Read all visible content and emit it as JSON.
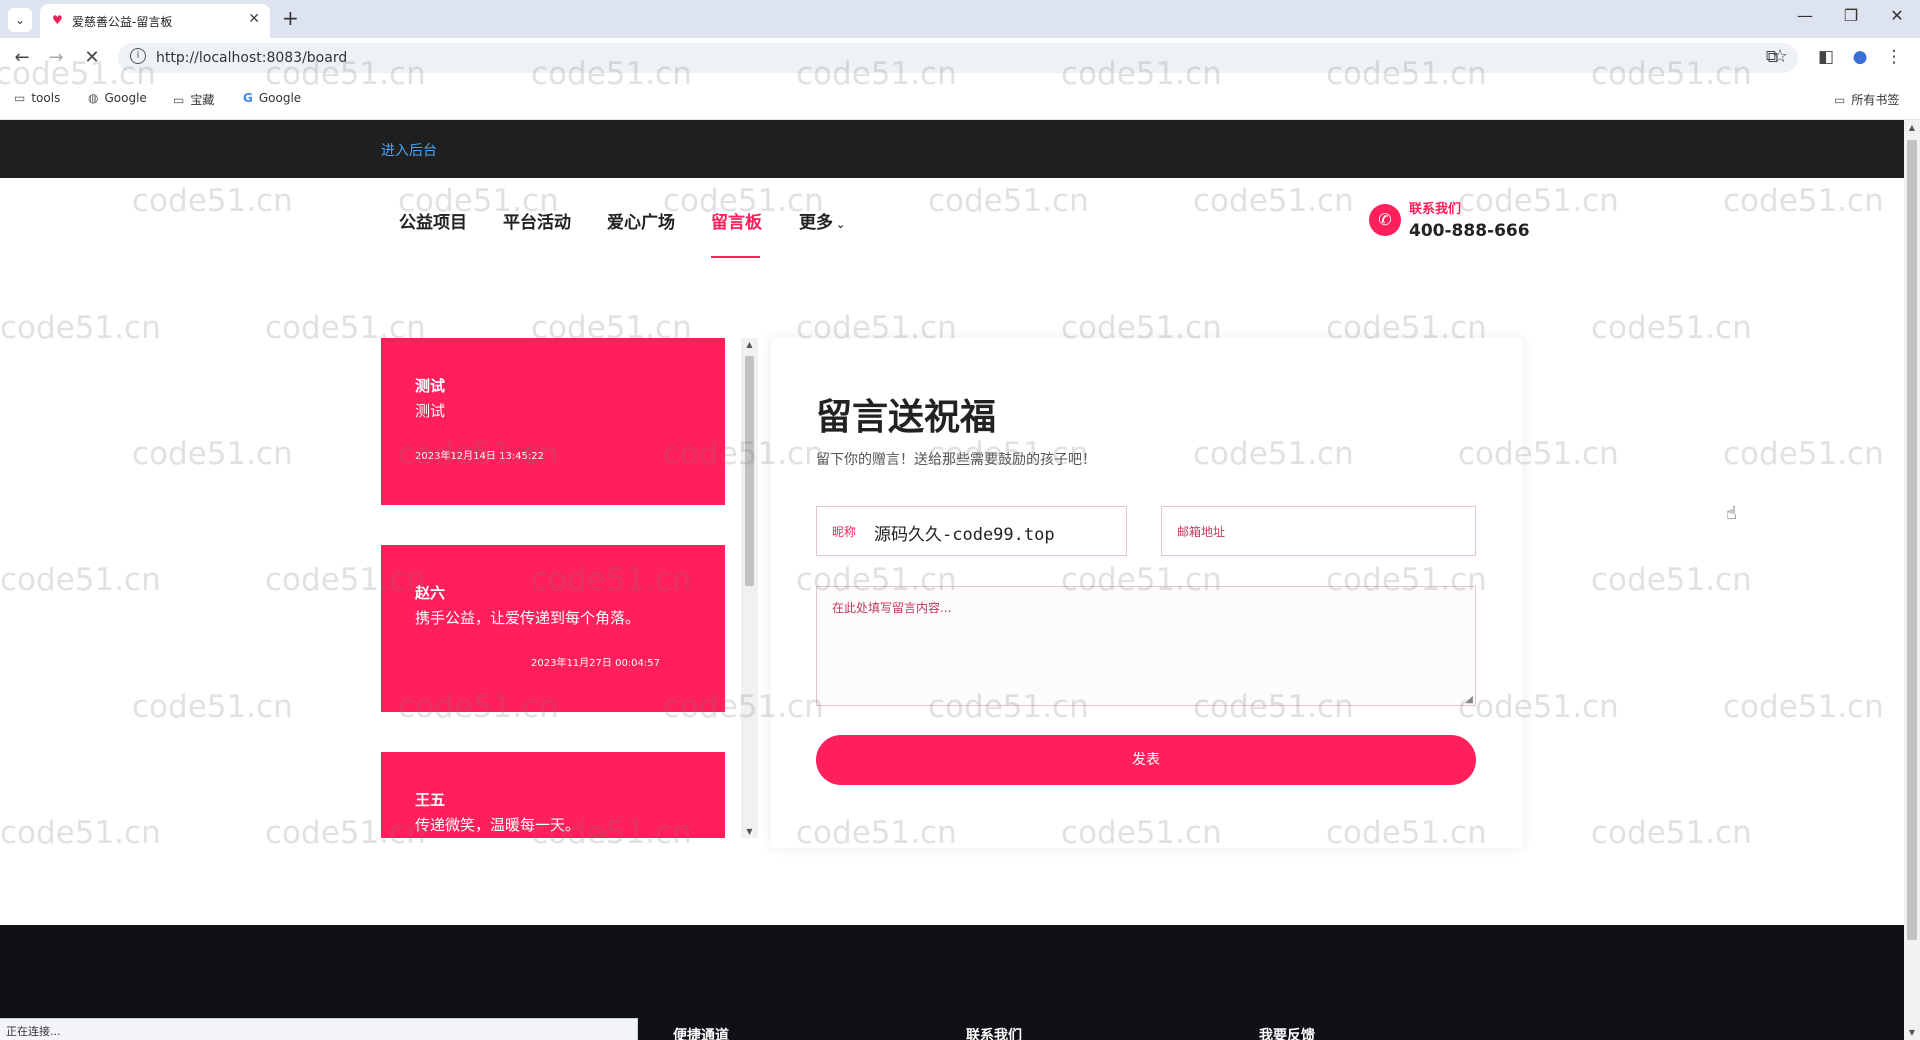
{
  "browser": {
    "tab_title": "爱慈善公益-留言板",
    "url": "http://localhost:8083/board",
    "bookmarks": [
      {
        "label": "tools",
        "icon": "folder-icon"
      },
      {
        "label": "Google",
        "icon": "globe-icon"
      },
      {
        "label": "宝藏",
        "icon": "folder-icon"
      },
      {
        "label": "Google",
        "icon": "google-icon"
      }
    ],
    "all_bookmarks": "所有书签",
    "status_text": "正在连接..."
  },
  "topbar": {
    "admin_link": "进入后台"
  },
  "nav": {
    "items": [
      "公益项目",
      "平台活动",
      "爱心广场",
      "留言板",
      "更多"
    ],
    "active": "留言板",
    "contact_label": "联系我们",
    "contact_phone": "400-888-666"
  },
  "messages": [
    {
      "name": "测试",
      "text": "测试",
      "time": "2023年12月14日 13:45:22"
    },
    {
      "name": "赵六",
      "text": "携手公益，让爱传递到每个角落。",
      "time": "2023年11月27日 00:04:57"
    },
    {
      "name": "王五",
      "text": "传递微笑，温暖每一天。",
      "time": ""
    }
  ],
  "form": {
    "title": "留言送祝福",
    "subtitle": "留下你的赠言！送给那些需要鼓励的孩子吧！",
    "nickname_label": "昵称",
    "nickname_value": "源码久久-code99.top",
    "email_placeholder": "邮箱地址",
    "content_placeholder": "在此处填写留言内容...",
    "submit_label": "发表"
  },
  "footer": {
    "columns": [
      "便捷通道",
      "联系我们",
      "我要反馈"
    ]
  },
  "watermark": "code51.cn",
  "colors": {
    "accent": "#ff1f5a",
    "topbar": "#1f1f1f",
    "footer": "#0f1117",
    "link": "#4aa3f0"
  }
}
